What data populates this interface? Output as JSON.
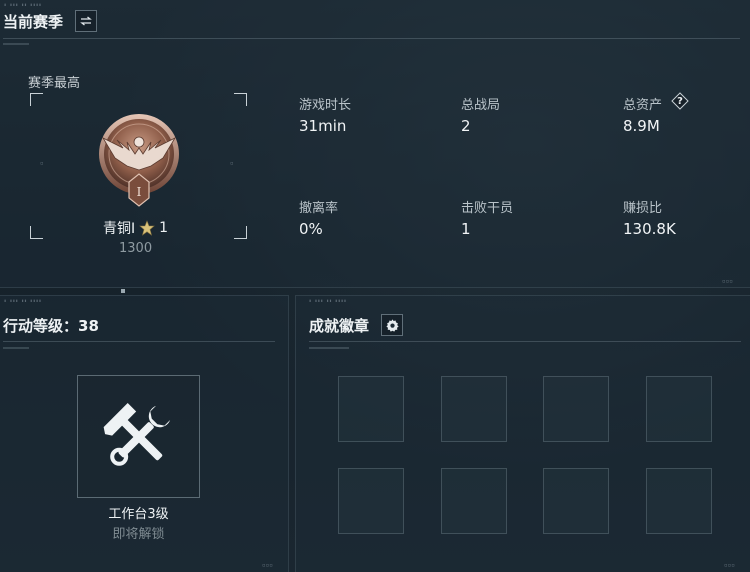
{
  "season": {
    "title": "当前赛季",
    "switch_icon": "swap-arrows-icon",
    "best_label": "赛季最高",
    "rank_name": "青铜I",
    "rank_stars": "1",
    "rank_score": "1300",
    "rank_roman": "I",
    "stats": [
      {
        "label": "游戏时长",
        "value": "31min"
      },
      {
        "label": "总战局",
        "value": "2"
      },
      {
        "label": "总资产",
        "value": "8.9M",
        "help": "?"
      },
      {
        "label": "撤离率",
        "value": "0%"
      },
      {
        "label": "击败干员",
        "value": "1"
      },
      {
        "label": "赚损比",
        "value": "130.8K"
      }
    ]
  },
  "action_level": {
    "title": "行动等级：38",
    "workbench_label": "工作台3级",
    "unlock_status": "即将解锁",
    "icon": "hammer-wrench-icon"
  },
  "achievements": {
    "title": "成就徽章",
    "settings_icon": "gear-icon",
    "slots": 8
  },
  "colors": {
    "background": "#16222b",
    "panel_border": "#8ca0aa",
    "text_primary": "#f1f4f6",
    "text_secondary": "#b9c3c9",
    "muted": "#8e9aa1",
    "medal_bronze": "#a0705a"
  }
}
